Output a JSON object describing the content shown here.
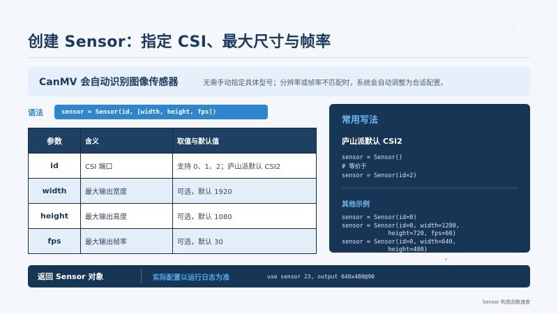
{
  "slide": {
    "title": "创建 Sensor：指定 CSI、最大尺寸与帧率",
    "page_number": "33",
    "caption": "Sensor 构造函数速查"
  },
  "banner": {
    "title": "CanMV 会自动识别图像传感器",
    "description": "无需手动指定具体型号；分辨率或帧率不匹配时，系统会自动调整为合适配置。"
  },
  "syntax": {
    "label": "语法",
    "code": "sensor = Sensor(id, [width, height, fps])"
  },
  "table": {
    "headers": [
      "参数",
      "含义",
      "取值与默认值"
    ],
    "rows": [
      [
        "id",
        "CSI 端口",
        "支持 0、1、2；庐山派默认 CSI2"
      ],
      [
        "width",
        "最大输出宽度",
        "可选，默认 1920"
      ],
      [
        "height",
        "最大输出高度",
        "可选，默认 1080"
      ],
      [
        "fps",
        "最大输出帧率",
        "可选，默认 30"
      ]
    ]
  },
  "panel": {
    "title": "常用写法",
    "subtitle": "庐山派默认 CSI2",
    "code_default": "sensor = Sensor()\n# 等价于\nsensor = Sensor(id=2)",
    "examples_title": "其他示例",
    "code_examples": "sensor = Sensor(id=0)\nsensor = Sensor(id=0, width=1280,\n             height=720, fps=60)\nsensor = Sensor(id=0, width=640,\n             height=480)"
  },
  "footer": {
    "returns": "返回 Sensor 对象",
    "note": "实际配置以运行日志为准",
    "log": "use sensor 23, output 640x480@90"
  },
  "colors": {
    "accent": "#2f86cc",
    "dark_navy": "#173554",
    "title": "#1c3a5e"
  }
}
